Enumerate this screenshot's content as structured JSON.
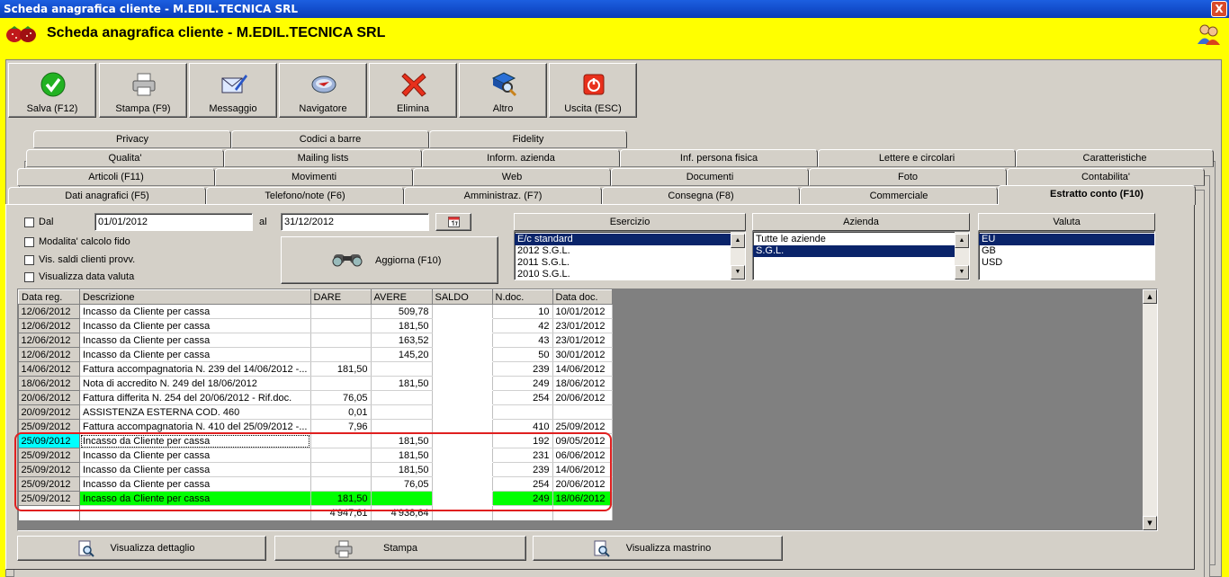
{
  "window": {
    "title": "Scheda anagrafica cliente - M.EDIL.TECNICA SRL",
    "close": "X"
  },
  "header": {
    "title": "Scheda anagrafica cliente - M.EDIL.TECNICA SRL"
  },
  "toolbar": {
    "save": "Salva (F12)",
    "print": "Stampa (F9)",
    "message": "Messaggio",
    "navigator": "Navigatore",
    "delete": "Elimina",
    "other": "Altro",
    "exit": "Uscita (ESC)"
  },
  "tabs": {
    "row1": [
      "Privacy",
      "Codici a barre",
      "Fidelity"
    ],
    "row2": [
      "Qualita'",
      "Mailing lists",
      "Inform. azienda",
      "Inf. persona fisica",
      "Lettere e circolari",
      "Caratteristiche"
    ],
    "row3": [
      "Articoli (F11)",
      "Movimenti",
      "Web",
      "Documenti",
      "Foto",
      "Contabilita'"
    ],
    "row4": [
      "Dati anagrafici (F5)",
      "Telefono/note (F6)",
      "Amministraz. (F7)",
      "Consegna (F8)",
      "Commerciale",
      "Estratto conto (F10)"
    ]
  },
  "filters": {
    "dal_label": "Dal",
    "dal_value": "01/01/2012",
    "al_label": "al",
    "al_value": "31/12/2012",
    "modalita": "Modalita' calcolo fido",
    "vis_saldi": "Vis. saldi clienti provv.",
    "vis_data_valuta": "Visualizza data valuta",
    "aggiorna": "Aggiorna (F10)",
    "calendar_icon": "calendar-icon"
  },
  "esercizio": {
    "header": "Esercizio",
    "items": [
      "E/c standard",
      "2012 S.G.L.",
      "2011 S.G.L.",
      "2010 S.G.L."
    ],
    "selected": "E/c standard"
  },
  "azienda": {
    "header": "Azienda",
    "items": [
      "Tutte le aziende",
      "S.G.L."
    ],
    "selected": "S.G.L."
  },
  "valuta": {
    "header": "Valuta",
    "items": [
      "EU",
      "GB",
      "USD"
    ],
    "selected": "EU"
  },
  "grid": {
    "columns": [
      "Data reg.",
      "Descrizione",
      "DARE",
      "AVERE",
      "SALDO",
      "N.doc.",
      "Data doc."
    ],
    "rows": [
      [
        "12/06/2012",
        "Incasso da Cliente per cassa",
        "",
        "509,78",
        "",
        "10",
        "10/01/2012"
      ],
      [
        "12/06/2012",
        "Incasso da Cliente per cassa",
        "",
        "181,50",
        "",
        "42",
        "23/01/2012"
      ],
      [
        "12/06/2012",
        "Incasso da Cliente per cassa",
        "",
        "163,52",
        "",
        "43",
        "23/01/2012"
      ],
      [
        "12/06/2012",
        "Incasso da Cliente per cassa",
        "",
        "145,20",
        "",
        "50",
        "30/01/2012"
      ],
      [
        "14/06/2012",
        "Fattura accompagnatoria N. 239 del 14/06/2012 -...",
        "181,50",
        "",
        "",
        "239",
        "14/06/2012"
      ],
      [
        "18/06/2012",
        "Nota di accredito N. 249 del 18/06/2012",
        "",
        "181,50",
        "",
        "249",
        "18/06/2012"
      ],
      [
        "20/06/2012",
        "Fattura differita N. 254 del 20/06/2012 - Rif.doc.",
        "76,05",
        "",
        "",
        "254",
        "20/06/2012"
      ],
      [
        "20/09/2012",
        "ASSISTENZA ESTERNA COD. 460",
        "0,01",
        "",
        "",
        "",
        ""
      ],
      [
        "25/09/2012",
        "Fattura accompagnatoria N. 410 del 25/09/2012 -...",
        "7,96",
        "",
        "",
        "410",
        "25/09/2012"
      ],
      [
        "25/09/2012",
        "Incasso da Cliente per cassa",
        "",
        "181,50",
        "",
        "192",
        "09/05/2012"
      ],
      [
        "25/09/2012",
        "Incasso da Cliente per cassa",
        "",
        "181,50",
        "",
        "231",
        "06/06/2012"
      ],
      [
        "25/09/2012",
        "Incasso da Cliente per cassa",
        "",
        "181,50",
        "",
        "239",
        "14/06/2012"
      ],
      [
        "25/09/2012",
        "Incasso da Cliente per cassa",
        "",
        "76,05",
        "",
        "254",
        "20/06/2012"
      ],
      [
        "25/09/2012",
        "Incasso da Cliente per cassa",
        "181,50",
        "",
        "",
        "249",
        "18/06/2012"
      ]
    ],
    "totals": {
      "dare": "4'947,61",
      "avere": "4'938,64"
    }
  },
  "bottom": {
    "dettaglio": "Visualizza dettaglio",
    "stampa": "Stampa",
    "mastrino": "Visualizza mastrino"
  },
  "colors": {
    "title_bar": "#0a3cb8",
    "background": "#ffff00",
    "panel": "#d4d0c8",
    "selection": "#0a246a",
    "highlight_cyan": "#00ffff",
    "highlight_green": "#00ff00",
    "annotation": "#e02020"
  }
}
